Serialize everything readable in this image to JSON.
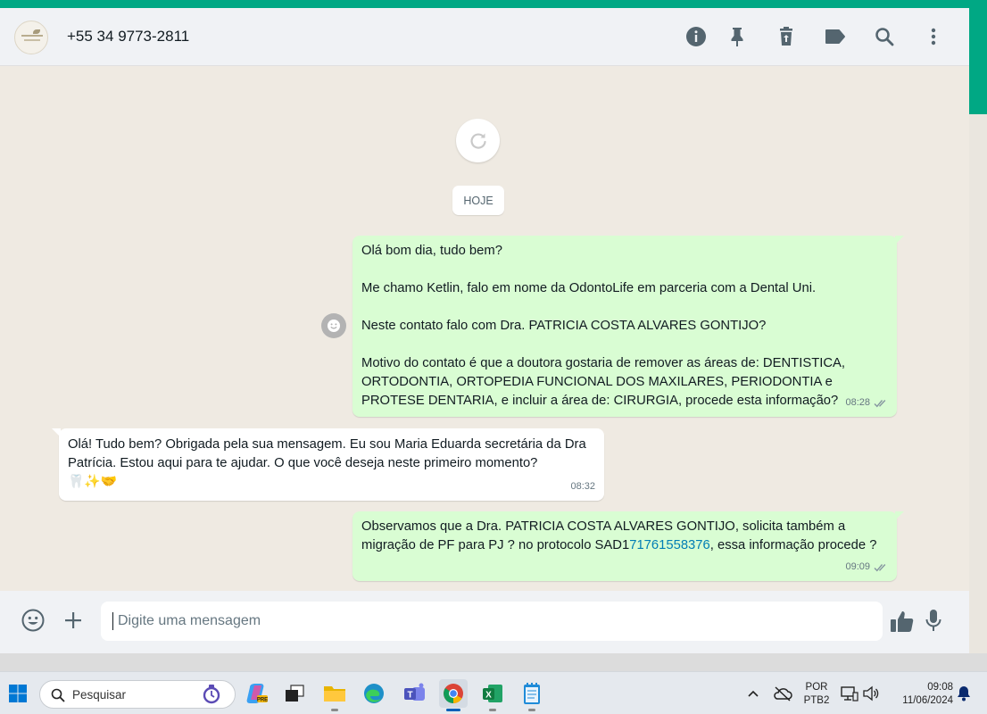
{
  "header": {
    "contact_name": "+55 34 9773-2811",
    "icons": [
      "info-icon",
      "pin-icon",
      "delete-icon",
      "label-icon",
      "search-icon",
      "menu-icon"
    ]
  },
  "chat": {
    "date_label": "HOJE",
    "messages": [
      {
        "direction": "outgoing",
        "lines": [
          "Olá bom dia, tudo bem?",
          "Me chamo Ketlin, falo em nome da OdontoLife em parceria com a Dental Uni.",
          "Neste contato falo com Dra. PATRICIA COSTA ALVARES GONTIJO?",
          "Motivo do contato é que a doutora gostaria de remover as áreas de:  DENTISTICA, ORTODONTIA, ORTOPEDIA FUNCIONAL DOS MAXILARES, PERIODONTIA e PROTESE DENTARIA, e incluir a área de: CIRURGIA, procede esta informação?"
        ],
        "time": "08:28",
        "status": "read"
      },
      {
        "direction": "incoming",
        "text": "Olá! Tudo bem? Obrigada pela sua mensagem. Eu sou Maria Eduarda  secretária da Dra Patrícia. Estou aqui para te ajudar. O que você deseja neste primeiro momento?",
        "emojis": "🦷✨🤝",
        "time": "08:32"
      },
      {
        "direction": "outgoing",
        "text_before": "Observamos que a Dra. PATRICIA COSTA ALVARES GONTIJO, solicita também a migração de PF para PJ ? no protocolo SAD1",
        "link": "71761558376",
        "text_after": ", essa informação procede ?",
        "time": "09:09",
        "status": "read"
      }
    ]
  },
  "composer": {
    "placeholder": "Digite uma mensagem"
  },
  "taskbar": {
    "search_placeholder": "Pesquisar",
    "language_line1": "POR",
    "language_line2": "PTB2",
    "clock_time": "09:08",
    "clock_date": "11/06/2024"
  },
  "colors": {
    "accent": "#00a884",
    "outgoing_bubble": "#d9fdd3",
    "incoming_bubble": "#ffffff",
    "chat_background": "#efeae2",
    "link": "#027eb5"
  }
}
